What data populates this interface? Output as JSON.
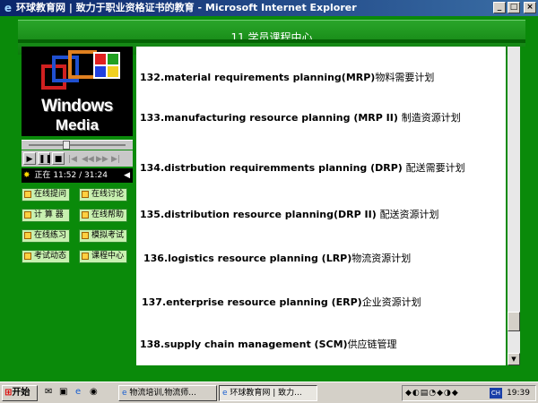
{
  "window": {
    "title": "环球教育网 | 致力于职业资格证书的教育 - Microsoft Internet Explorer",
    "buttons": [
      "minimize",
      "maximize",
      "close"
    ]
  },
  "header": {
    "title": "11  学员课程中心"
  },
  "player": {
    "logo_line1": "Windows",
    "logo_line2": "Media",
    "status_label": "正在",
    "time": "11:52 / 31:24",
    "progress_fraction": 0.38
  },
  "nav": [
    {
      "label": "在线提问"
    },
    {
      "label": "在线讨论"
    },
    {
      "label": "计 算 器"
    },
    {
      "label": "在线帮助"
    },
    {
      "label": "在线练习"
    },
    {
      "label": "模拟考试"
    },
    {
      "label": "考试动态"
    },
    {
      "label": "课程中心"
    }
  ],
  "terms": [
    {
      "en": "132.material requirements planning(MRP)",
      "cn": "物料需要计划"
    },
    {
      "en": "133.manufacturing resource planning (MRP II) ",
      "cn": "制造资源计划"
    },
    {
      "en": "134.distrbution requiremments planning (DRP) ",
      "cn": "配送需要计划"
    },
    {
      "en": "135.distribution resource planning(DRP II) ",
      "cn": "配送资源计划"
    },
    {
      "en": "136.logistics  resource  planning (LRP)",
      "cn": "物流资源计划"
    },
    {
      "en": "137.enterprise  resource  planning (ERP)",
      "cn": "企业资源计划"
    },
    {
      "en": "138.supply  chain  management  (SCM)",
      "cn": "供应链管理"
    }
  ],
  "taskbar": {
    "start_label": "开始",
    "tasks": [
      {
        "label": "物流培训,物流师..."
      },
      {
        "label": "环球教育网 | 致力..."
      }
    ],
    "lang": "CH",
    "clock": "19:39"
  }
}
